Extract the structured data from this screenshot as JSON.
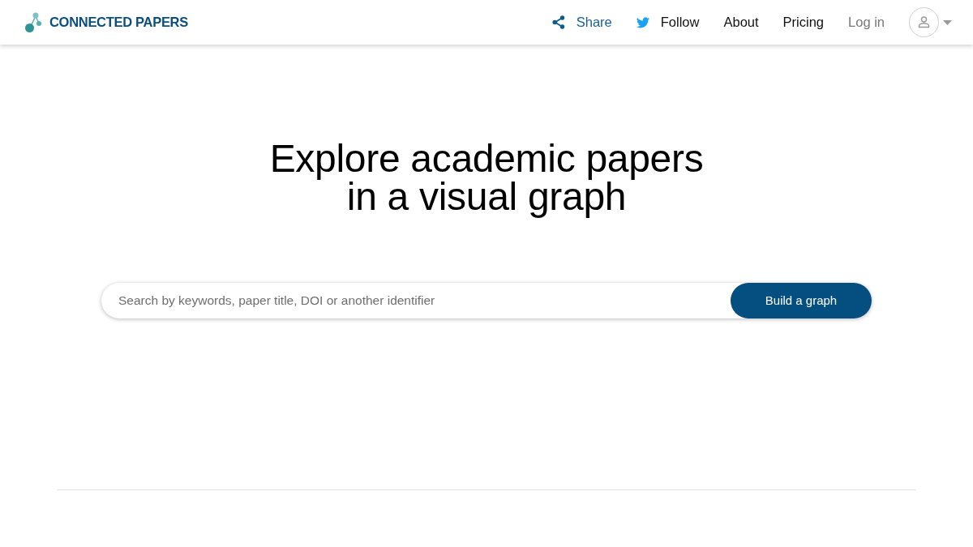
{
  "header": {
    "logo": {
      "text": "CONNECTED PAPERS"
    },
    "nav": [
      {
        "kind": "share",
        "label": "Share"
      },
      {
        "kind": "twitter",
        "label": "Follow"
      },
      {
        "kind": "link",
        "label": "About"
      },
      {
        "kind": "link",
        "label": "Pricing"
      },
      {
        "kind": "login",
        "label": "Log in"
      }
    ]
  },
  "hero": {
    "title_lines": [
      "Explore academic papers",
      "in a visual graph"
    ],
    "search": {
      "placeholder": "Search by keywords, paper title, DOI or another identifier"
    },
    "button": "Build a graph"
  }
}
